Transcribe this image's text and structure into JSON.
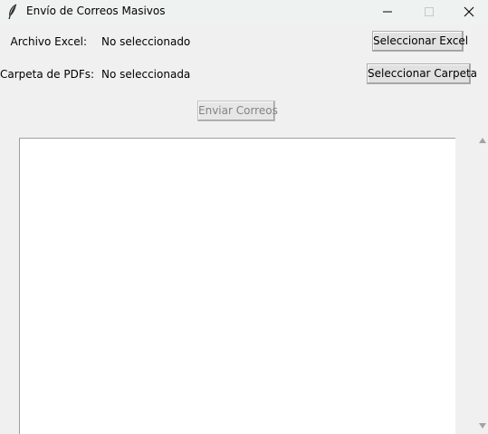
{
  "window": {
    "title": "Envío de Correos Masivos",
    "icon": "feather-icon"
  },
  "form": {
    "excel_label": "Archivo Excel:",
    "excel_value": "No seleccionado",
    "excel_button": "Seleccionar Excel",
    "pdf_label": "Carpeta de PDFs:",
    "pdf_value": "No seleccionada",
    "pdf_button": "Seleccionar Carpeta"
  },
  "actions": {
    "send_button": "Enviar Correos",
    "send_enabled": false
  },
  "log": {
    "content": ""
  }
}
